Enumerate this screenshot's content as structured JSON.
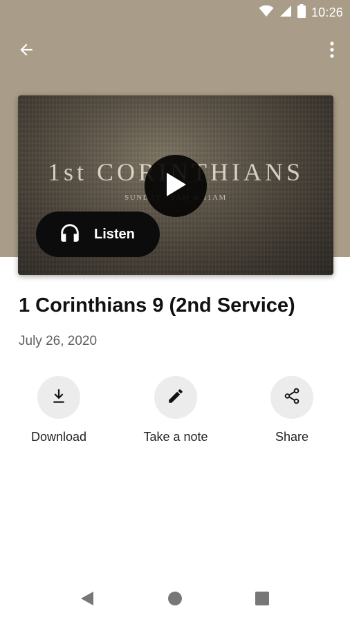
{
  "status_bar": {
    "time": "10:26",
    "icons": [
      "wifi-icon",
      "cell-signal-icon",
      "battery-icon"
    ]
  },
  "toolbar": {
    "back_icon": "arrow-back-icon",
    "more_icon": "more-vert-icon"
  },
  "media": {
    "artwork_title": "1st CORINTHIANS",
    "artwork_subtitle": "SUNDAY · 9AM & 11AM",
    "play_icon": "play-icon",
    "listen_label": "Listen",
    "listen_icon": "headphones-icon"
  },
  "sermon": {
    "title": "1 Corinthians 9 (2nd Service)",
    "date": "July 26, 2020"
  },
  "actions": [
    {
      "label": "Download",
      "icon": "download-icon"
    },
    {
      "label": "Take a note",
      "icon": "pencil-icon"
    },
    {
      "label": "Share",
      "icon": "share-icon"
    }
  ],
  "nav": {
    "back_icon": "nav-back-icon",
    "home_icon": "nav-home-icon",
    "recents_icon": "nav-recents-icon"
  },
  "colors": {
    "header_bg": "#a99c88",
    "button_dark": "#0c0c0c",
    "action_circle": "#ececec"
  }
}
